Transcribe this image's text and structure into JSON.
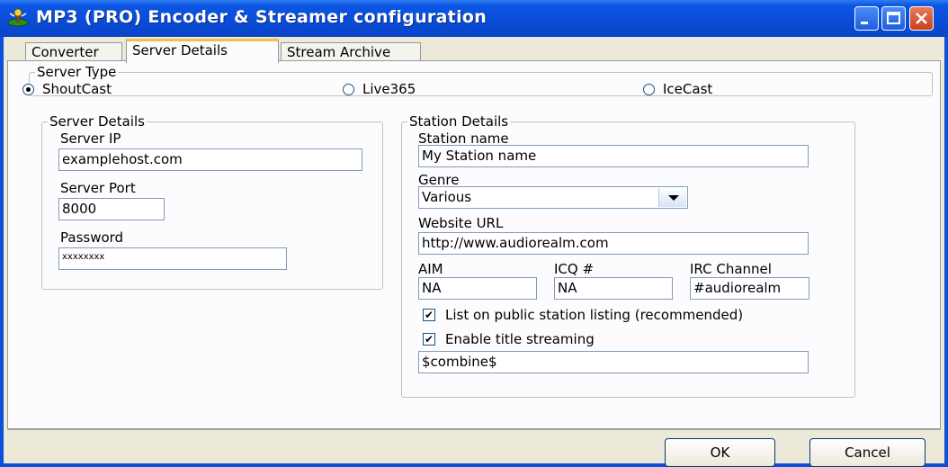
{
  "window": {
    "title": "MP3 (PRO) Encoder & Streamer configuration",
    "icon": "streamer-app-icon",
    "controls": [
      "minimize-icon",
      "maximize-icon",
      "close-icon"
    ],
    "colors": {
      "titlebar": "#0a50d8",
      "face": "#ece9d8",
      "close": "#c8401c"
    }
  },
  "tabs": [
    {
      "label": "Converter",
      "active": false
    },
    {
      "label": "Server Details",
      "active": true
    },
    {
      "label": "Stream Archive",
      "active": false
    }
  ],
  "server_type": {
    "legend": "Server Type",
    "options": [
      {
        "label": "ShoutCast",
        "selected": true
      },
      {
        "label": "Live365",
        "selected": false
      },
      {
        "label": "IceCast",
        "selected": false
      }
    ]
  },
  "server_details": {
    "legend": "Server Details",
    "ip_label": "Server IP",
    "ip_value": "examplehost.com",
    "port_label": "Server Port",
    "port_value": "8000",
    "password_label": "Password",
    "password_value": "xxxxxxxx"
  },
  "station_details": {
    "legend": "Station Details",
    "name_label": "Station name",
    "name_value": "My Station name",
    "genre_label": "Genre",
    "genre_value": "Various",
    "website_label": "Website URL",
    "website_value": "http://www.audiorealm.com",
    "aim_label": "AIM",
    "aim_value": "NA",
    "icq_label": "ICQ #",
    "icq_value": "NA",
    "irc_label": "IRC Channel",
    "irc_value": "#audiorealm",
    "public_listing_label": "List on public station listing (recommended)",
    "public_listing_checked": true,
    "title_streaming_label": "Enable title streaming",
    "title_streaming_checked": true,
    "title_format_value": "$combine$"
  },
  "buttons": {
    "ok": "OK",
    "cancel": "Cancel"
  }
}
